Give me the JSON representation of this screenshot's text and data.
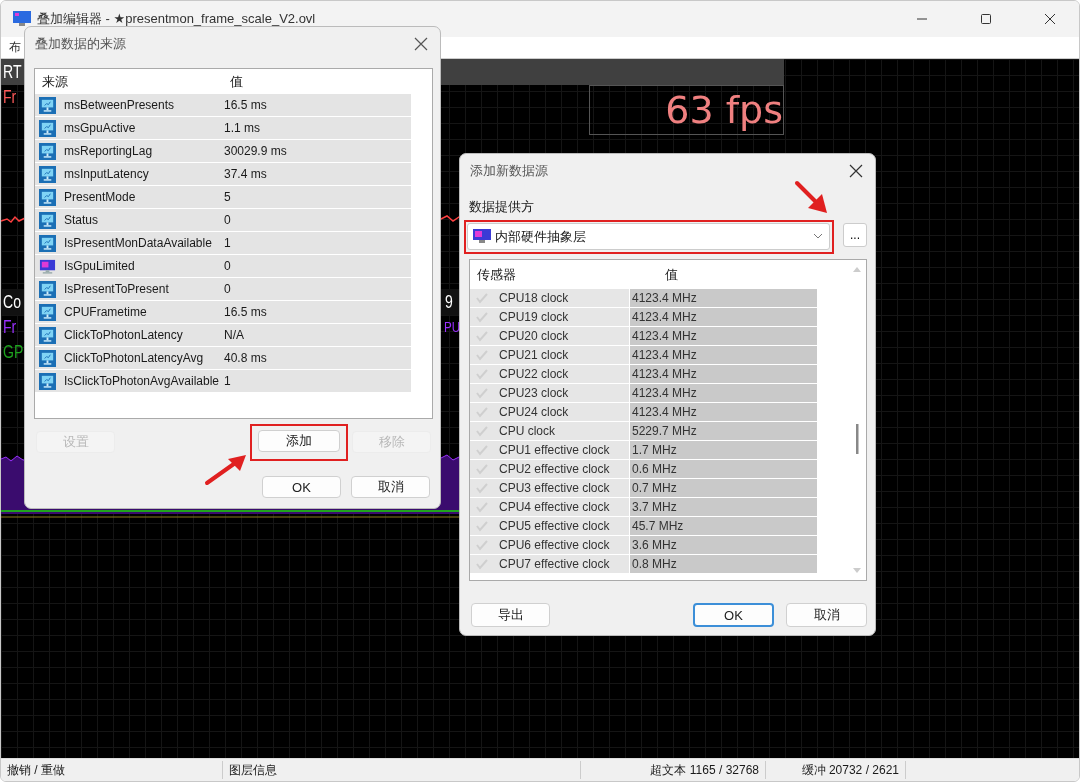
{
  "window": {
    "title": "叠加编辑器 - ★presentmon_frame_scale_V2.ovl"
  },
  "tab": "布",
  "canvas": {
    "labels": [
      {
        "text": "RT",
        "color": "#ffffff"
      },
      {
        "text": "Fr",
        "color": "#ff5a5a"
      },
      {
        "text": "Co",
        "color": "#ffffff"
      },
      {
        "text": "9",
        "color": "#ffffff"
      },
      {
        "text": "Fr",
        "color": "#9b30ff"
      },
      {
        "text": "PU",
        "color": "#9b30ff"
      },
      {
        "text": "GP",
        "color": "#1fa31f"
      }
    ],
    "fps_readout": "63 fps"
  },
  "sources_dialog": {
    "title": "叠加数据的来源",
    "columns": [
      "来源",
      "值"
    ],
    "rows": [
      {
        "name": "msBetweenPresents",
        "value": "16.5 ms",
        "kind": "presentmon"
      },
      {
        "name": "msGpuActive",
        "value": "1.1 ms",
        "kind": "presentmon"
      },
      {
        "name": "msReportingLag",
        "value": "30029.9 ms",
        "kind": "presentmon"
      },
      {
        "name": "msInputLatency",
        "value": "37.4 ms",
        "kind": "presentmon"
      },
      {
        "name": "PresentMode",
        "value": "5",
        "kind": "presentmon"
      },
      {
        "name": "Status",
        "value": "0",
        "kind": "presentmon"
      },
      {
        "name": "IsPresentMonDataAvailable",
        "value": "1",
        "kind": "presentmon"
      },
      {
        "name": "IsGpuLimited",
        "value": "0",
        "kind": "hal"
      },
      {
        "name": "IsPresentToPresent",
        "value": "0",
        "kind": "presentmon"
      },
      {
        "name": "CPUFrametime",
        "value": "16.5 ms",
        "kind": "presentmon"
      },
      {
        "name": "ClickToPhotonLatency",
        "value": "N/A",
        "kind": "presentmon"
      },
      {
        "name": "ClickToPhotonLatencyAvg",
        "value": "40.8 ms",
        "kind": "presentmon"
      },
      {
        "name": "IsClickToPhotonAvgAvailable",
        "value": "1",
        "kind": "presentmon"
      }
    ],
    "actions": [
      {
        "label": "设置",
        "disabled": true,
        "highlighted": false
      },
      {
        "label": "添加",
        "disabled": false,
        "highlighted": true
      },
      {
        "label": "移除",
        "disabled": true,
        "highlighted": false
      }
    ],
    "footer_buttons": [
      {
        "label": "OK",
        "default": false
      },
      {
        "label": "取消",
        "default": false
      }
    ]
  },
  "add_dialog": {
    "title": "添加新数据源",
    "provider_label": "数据提供方",
    "provider": "内部硬件抽象层",
    "provider_highlighted": true,
    "more_button": "...",
    "columns": [
      "传感器",
      "值"
    ],
    "rows": [
      {
        "name": "CPU18 clock",
        "value": "4123.4 MHz"
      },
      {
        "name": "CPU19 clock",
        "value": "4123.4 MHz"
      },
      {
        "name": "CPU20 clock",
        "value": "4123.4 MHz"
      },
      {
        "name": "CPU21 clock",
        "value": "4123.4 MHz"
      },
      {
        "name": "CPU22 clock",
        "value": "4123.4 MHz"
      },
      {
        "name": "CPU23 clock",
        "value": "4123.4 MHz"
      },
      {
        "name": "CPU24 clock",
        "value": "4123.4 MHz"
      },
      {
        "name": "CPU clock",
        "value": "5229.7 MHz"
      },
      {
        "name": "CPU1 effective clock",
        "value": "1.7 MHz"
      },
      {
        "name": "CPU2 effective clock",
        "value": "0.6 MHz"
      },
      {
        "name": "CPU3 effective clock",
        "value": "0.7 MHz"
      },
      {
        "name": "CPU4 effective clock",
        "value": "3.7 MHz"
      },
      {
        "name": "CPU5 effective clock",
        "value": "45.7 MHz"
      },
      {
        "name": "CPU6 effective clock",
        "value": "3.6 MHz"
      },
      {
        "name": "CPU7 effective clock",
        "value": "0.8 MHz"
      }
    ],
    "left_button": {
      "label": "导出"
    },
    "footer_buttons": [
      {
        "label": "OK",
        "default": true
      },
      {
        "label": "取消",
        "default": false
      }
    ]
  },
  "status_bar": [
    "撤销 / 重做",
    "图层信息",
    "超文本 1165 / 32768",
    "缓冲 20732 / 2621"
  ]
}
